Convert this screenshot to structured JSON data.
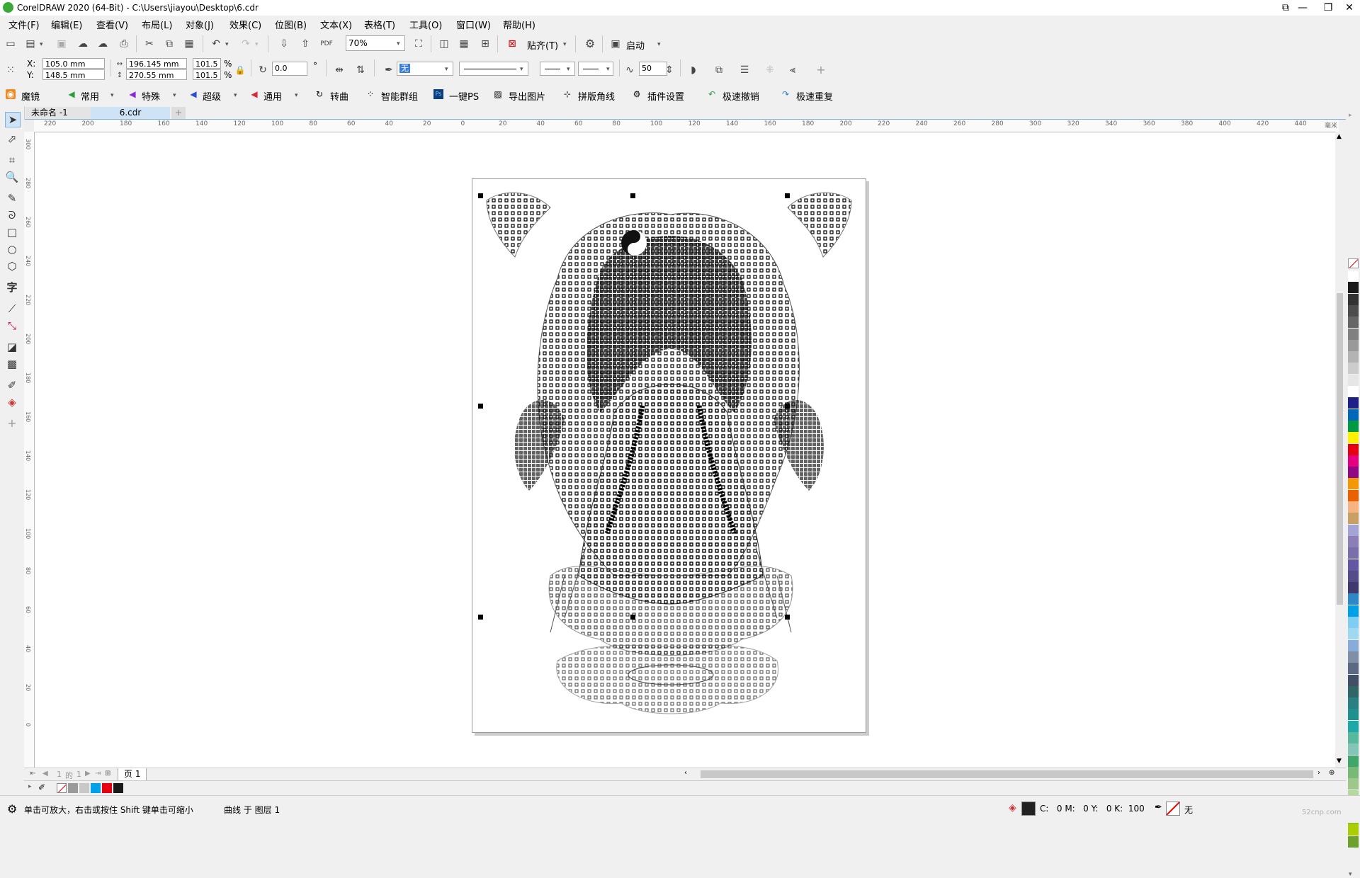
{
  "window": {
    "title": "CorelDRAW 2020 (64-Bit) - C:\\Users\\jiayou\\Desktop\\6.cdr",
    "controls": [
      "⧉",
      "—",
      "❐",
      "✕"
    ]
  },
  "menu": [
    "文件(F)",
    "编辑(E)",
    "查看(V)",
    "布局(L)",
    "对象(J)",
    "效果(C)",
    "位图(B)",
    "文本(X)",
    "表格(T)",
    "工具(O)",
    "窗口(W)",
    "帮助(H)"
  ],
  "standard_toolbar": {
    "zoom": "70%",
    "snap_label": "贴齐(T)",
    "launch_label": "启动"
  },
  "property_bar": {
    "x_label": "X:",
    "y_label": "Y:",
    "x_value": "105.0 mm",
    "y_value": "148.5 mm",
    "width_value": "196.145 mm",
    "height_value": "270.55 mm",
    "scale_w": "101.5",
    "scale_h": "101.5",
    "percent": "%",
    "rotation": "0.0",
    "degree": "°",
    "fill_value": "无",
    "smooth_value": "50"
  },
  "plugin_toolbar": [
    "魔镜",
    "常用",
    "特殊",
    "超级",
    "通用",
    "转曲",
    "智能群组",
    "一键PS",
    "导出图片",
    "拼版角线",
    "插件设置",
    "极速撤销",
    "极速重复"
  ],
  "doc_tabs": [
    "未命名 -1",
    "6.cdr",
    "+"
  ],
  "hruler_ticks": [
    "220",
    "200",
    "180",
    "160",
    "140",
    "120",
    "100",
    "80",
    "60",
    "40",
    "20",
    "0",
    "20",
    "40",
    "60",
    "80",
    "100",
    "120",
    "140",
    "160",
    "180",
    "200",
    "220",
    "240",
    "260",
    "280",
    "300",
    "320",
    "340",
    "360",
    "380",
    "400",
    "420",
    "440"
  ],
  "hruler_unit": "毫米",
  "vruler_ticks": [
    "300",
    "280",
    "260",
    "240",
    "220",
    "200",
    "180",
    "160",
    "140",
    "120",
    "100",
    "80",
    "60",
    "40",
    "20",
    "0"
  ],
  "page_nav": {
    "current": "1",
    "of": "的",
    "total": "1",
    "page_tab": "页 1"
  },
  "status": {
    "hint": "单击可放大，右击或按住 Shift 键单击可缩小",
    "object": "曲线 于 图层 1",
    "cmyk": "C:   0 M:   0 Y:   0 K:  100",
    "outline": "无"
  },
  "palette_colors": [
    "#ffffff",
    "#1a1a1a",
    "#333333",
    "#4d4d4d",
    "#666666",
    "#808080",
    "#999999",
    "#b3b3b3",
    "#cccccc",
    "#e6e6e6",
    "#ffffff",
    "#1d2088",
    "#0068b7",
    "#009944",
    "#fff100",
    "#e60012",
    "#e4007f",
    "#920783",
    "#f39800",
    "#eb6100",
    "#f6b37f",
    "#c9a063",
    "#a3a3d5",
    "#8c7fb7",
    "#7b6fab",
    "#6356a3",
    "#534c88",
    "#3e3a6d",
    "#2e88c8",
    "#00a0e9",
    "#7ecef4",
    "#a0d8ef",
    "#88abda",
    "#7e8fa6",
    "#5b6a82",
    "#434f66",
    "#316667",
    "#2a7f82",
    "#20908f",
    "#1fa8a8",
    "#56b89c",
    "#83c6b7",
    "#3fa76a",
    "#77b975",
    "#9ec88a",
    "#b5d99c",
    "#c9e0aa",
    "#8fc31f",
    "#abcd03",
    "#6ca22b"
  ],
  "doc_palette": [
    "#ffffff",
    "#9a9a9a",
    "#c8c8c8",
    "#00a0e9",
    "#e60012",
    "#1a1a1a"
  ],
  "watermark": "52cnp.com"
}
